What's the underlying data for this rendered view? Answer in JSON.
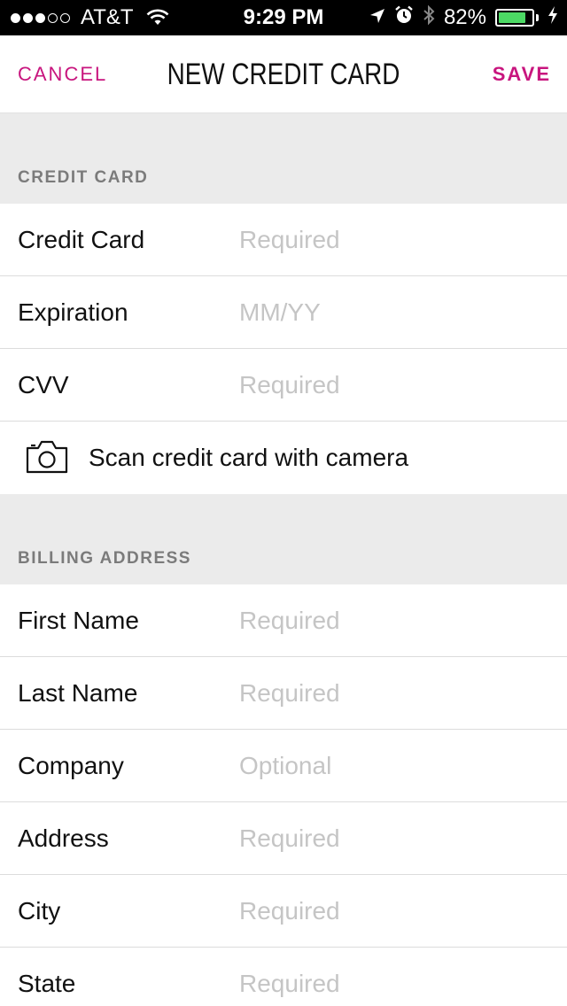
{
  "status_bar": {
    "signal_bars_filled": 3,
    "signal_bars_total": 5,
    "carrier": "AT&T",
    "time": "9:29 PM",
    "battery_percent_label": "82%",
    "battery_level": 0.82,
    "battery_color": "#4cd964",
    "icons": [
      "wifi-icon",
      "location-arrow-icon",
      "alarm-icon",
      "bluetooth-icon",
      "battery-icon",
      "charging-bolt-icon"
    ]
  },
  "nav": {
    "cancel_label": "CANCEL",
    "title": "NEW CREDIT CARD",
    "save_label": "SAVE",
    "accent_color": "#c8157e"
  },
  "sections": {
    "credit_card_header": "CREDIT CARD",
    "billing_header": "BILLING ADDRESS"
  },
  "credit_card_fields": [
    {
      "label": "Credit Card",
      "placeholder": "Required"
    },
    {
      "label": "Expiration",
      "placeholder": "MM/YY"
    },
    {
      "label": "CVV",
      "placeholder": "Required"
    }
  ],
  "scan": {
    "label": "Scan credit card with camera",
    "icon": "camera-icon"
  },
  "billing_fields": [
    {
      "label": "First Name",
      "placeholder": "Required"
    },
    {
      "label": "Last Name",
      "placeholder": "Required"
    },
    {
      "label": "Company",
      "placeholder": "Optional"
    },
    {
      "label": "Address",
      "placeholder": "Required"
    },
    {
      "label": "City",
      "placeholder": "Required"
    },
    {
      "label": "State",
      "placeholder": "Required"
    }
  ]
}
